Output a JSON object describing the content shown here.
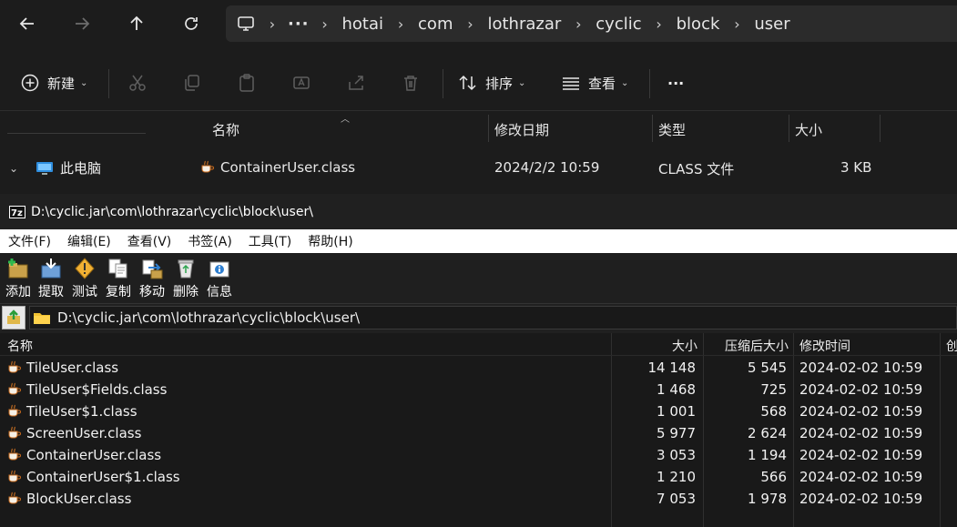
{
  "explorer": {
    "nav": {
      "back": "back-arrow-icon",
      "forward": "forward-arrow-icon",
      "up": "up-arrow-icon",
      "refresh": "refresh-icon"
    },
    "breadcrumb": {
      "more": "···",
      "segments": [
        "hotai",
        "com",
        "lothrazar",
        "cyclic",
        "block",
        "user"
      ]
    },
    "commands": {
      "new_label": "新建",
      "sort_label": "排序",
      "view_label": "查看",
      "more_label": "···"
    },
    "sidebar": {
      "this_pc": "此电脑"
    },
    "columns": {
      "name": "名称",
      "modified": "修改日期",
      "type": "类型",
      "size": "大小"
    },
    "rows": [
      {
        "name": "ContainerUser.class",
        "modified": "2024/2/2 10:59",
        "type": "CLASS 文件",
        "size": "3 KB"
      }
    ]
  },
  "zip": {
    "title": "D:\\cyclic.jar\\com\\lothrazar\\cyclic\\block\\user\\",
    "menu": [
      "文件(F)",
      "编辑(E)",
      "查看(V)",
      "书签(A)",
      "工具(T)",
      "帮助(H)"
    ],
    "toolbar": [
      "添加",
      "提取",
      "测试",
      "复制",
      "移动",
      "删除",
      "信息"
    ],
    "path": "D:\\cyclic.jar\\com\\lothrazar\\cyclic\\block\\user\\",
    "columns": {
      "name": "名称",
      "size": "大小",
      "packed": "压缩后大小",
      "modified": "修改时间",
      "created": "创"
    },
    "rows": [
      {
        "name": "TileUser.class",
        "size": "14 148",
        "packed": "5 545",
        "modified": "2024-02-02 10:59"
      },
      {
        "name": "TileUser$Fields.class",
        "size": "1 468",
        "packed": "725",
        "modified": "2024-02-02 10:59"
      },
      {
        "name": "TileUser$1.class",
        "size": "1 001",
        "packed": "568",
        "modified": "2024-02-02 10:59"
      },
      {
        "name": "ScreenUser.class",
        "size": "5 977",
        "packed": "2 624",
        "modified": "2024-02-02 10:59"
      },
      {
        "name": "ContainerUser.class",
        "size": "3 053",
        "packed": "1 194",
        "modified": "2024-02-02 10:59"
      },
      {
        "name": "ContainerUser$1.class",
        "size": "1 210",
        "packed": "566",
        "modified": "2024-02-02 10:59"
      },
      {
        "name": "BlockUser.class",
        "size": "7 053",
        "packed": "1 978",
        "modified": "2024-02-02 10:59"
      }
    ]
  },
  "colors": {
    "explorer_bg": "#1c1c1c",
    "zip_bg": "#202020",
    "list_bg": "#191919",
    "menu_bg": "#ffffff",
    "address_bg": "#2b2b2b"
  }
}
